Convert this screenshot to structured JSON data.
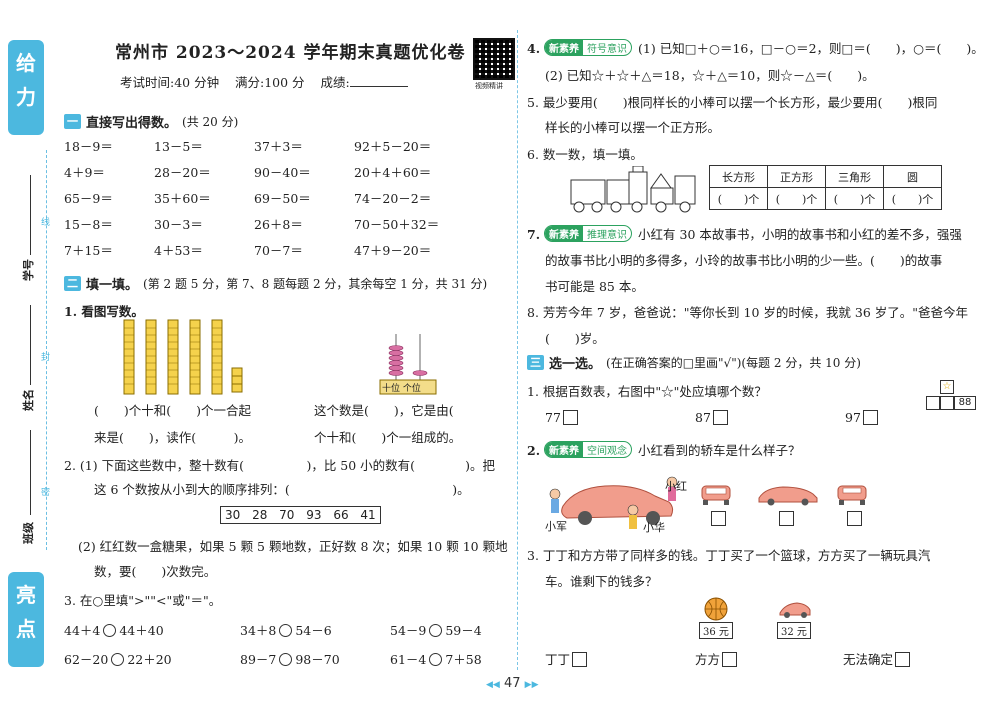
{
  "strip": {
    "top_label": "给力",
    "bottom_label": "亮点",
    "fields": [
      "学号",
      "姓名",
      "班级"
    ],
    "binding_marks": [
      "线",
      "封",
      "密"
    ]
  },
  "header": {
    "title": "常州市 2023～2024 学年期末真题优化卷",
    "time": "考试时间:40 分钟",
    "score": "满分:100 分",
    "result": "成绩:",
    "qr_label": "视频精讲"
  },
  "section1": {
    "num": "一",
    "title": "直接写出得数。",
    "note": "(共 20 分)",
    "items": [
      "18－9＝",
      "13－5＝",
      "37＋3＝",
      "92＋5－20＝",
      "4＋9＝",
      "28－20＝",
      "90－40＝",
      "20＋4＋60＝",
      "65－9＝",
      "35＋60＝",
      "69－50＝",
      "74－20－2＝",
      "15－8＝",
      "30－3＝",
      "26＋8＝",
      "70－50＋32＝",
      "7＋15＝",
      "4＋53＝",
      "70－7＝",
      "47＋9－20＝"
    ]
  },
  "section2": {
    "num": "二",
    "title": "填一填。",
    "note": "(第 2 题 5 分，第 7、8 题每题 2 分，其余每空 1 分，共 31 分)",
    "q1_label": "1. 看图写数。",
    "q1_line1": "(　　)个十和(　　)个一合起",
    "q1_line2": "来是(　　)，读作(　　　)。",
    "q1_line3": "这个数是(　　)，它是由(　　",
    "q1_line4": "个十和(　　)个一组成的。",
    "abacus_label": "十位 个位",
    "q2_line1": "2. (1) 下面这些数中，整十数有(　　　　　)，比 50 小的数有(　　　　)。把",
    "q2_line2": "这 6 个数按从小到大的顺序排列：(　　　　　　　　　　　　　)。",
    "q2_numbers": "30 28 70 93 66 41",
    "q2_line3": "(2) 红红数一盒糖果，如果 5 颗 5 颗地数，正好数 8 次；如果 10 颗 10 颗地",
    "q2_line4": "数，要(　　)次数完。",
    "q3_line": "3. 在○里填\">\"\"<\"或\"＝\"。",
    "q3_items": [
      "44＋4",
      "44＋40",
      "34＋8",
      "54－6",
      "54－9",
      "59－4",
      "62－20",
      "22＋20",
      "89－7",
      "98－70",
      "61－4",
      "7＋58"
    ]
  },
  "right": {
    "q4_badge1": "新素养",
    "q4_badge2": "符号意识",
    "q4_line1": "(1) 已知□＋○＝16，□－○＝2，则□＝(　　)，○＝(　　)。",
    "q4_line2": "(2) 已知☆＋☆＋△＝18，☆＋△＝10，则☆－△＝(　　)。",
    "q5_line1": "5. 最少要用(　　)根同样长的小棒可以摆一个长方形，最少要用(　　)根同",
    "q5_line2": "样长的小棒可以摆一个正方形。",
    "q6_line": "6. 数一数，填一填。",
    "q6_headers": [
      "长方形",
      "正方形",
      "三角形",
      "圆"
    ],
    "q6_cells": [
      "(　　)个",
      "(　　)个",
      "(　　)个",
      "(　　)个"
    ],
    "q7_badge1": "新素养",
    "q7_badge2": "推理意识",
    "q7_line1": "小红有 30 本故事书，小明的故事书和小红的差不多，强强",
    "q7_line2": "的故事书比小明的多得多，小玲的故事书比小明的少一些。(　　)的故事",
    "q7_line3": "书可能是 85 本。",
    "q8_line1": "8. 芳芳今年 7 岁，爸爸说：\"等你长到 10 岁的时候，我就 36 岁了。\"爸爸今年",
    "q8_line2": "(　　)岁。",
    "sec3_num": "三",
    "sec3_title": "选一选。",
    "sec3_note": "(在正确答案的□里画\"√\")(每题 2 分，共 10 分)",
    "s1_line": "1. 根据百数表，右图中\"☆\"处应填哪个数？",
    "s1_options": [
      "77",
      "87",
      "97"
    ],
    "s1_cell": "88",
    "s2_badge1": "新素养",
    "s2_badge2": "空间观念",
    "s2_line": "小红看到的轿车是什么样子？",
    "s2_names": [
      "小红",
      "小军",
      "小华"
    ],
    "s3_line1": "3. 丁丁和方方带了同样多的钱。丁丁买了一个篮球，方方买了一辆玩具汽",
    "s3_line2": "车。谁剩下的钱多？",
    "s3_prices": [
      "36 元",
      "32 元"
    ],
    "s3_options": [
      "丁丁",
      "方方",
      "无法确定"
    ]
  },
  "page_number": "47"
}
